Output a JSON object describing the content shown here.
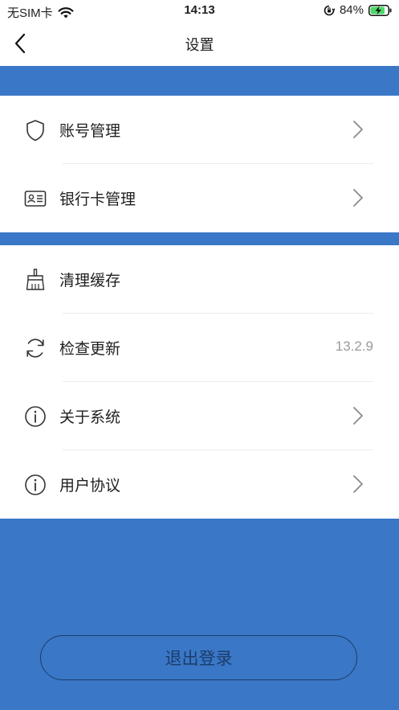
{
  "status_bar": {
    "carrier": "无SIM卡",
    "time": "14:13",
    "battery": "84%"
  },
  "nav": {
    "title": "设置"
  },
  "group1": [
    {
      "label": "账号管理",
      "icon": "shield-icon"
    },
    {
      "label": "银行卡管理",
      "icon": "id-card-icon"
    }
  ],
  "group2": [
    {
      "label": "清理缓存",
      "icon": "broom-icon"
    },
    {
      "label": "检查更新",
      "icon": "refresh-icon",
      "value": "13.2.9"
    },
    {
      "label": "关于系统",
      "icon": "info-icon"
    },
    {
      "label": "用户协议",
      "icon": "info-icon"
    }
  ],
  "logout_label": "退出登录",
  "colors": {
    "accent": "#3a77c6",
    "logout_text": "#1b3d6b",
    "secondary_text": "#9a9a9a"
  }
}
